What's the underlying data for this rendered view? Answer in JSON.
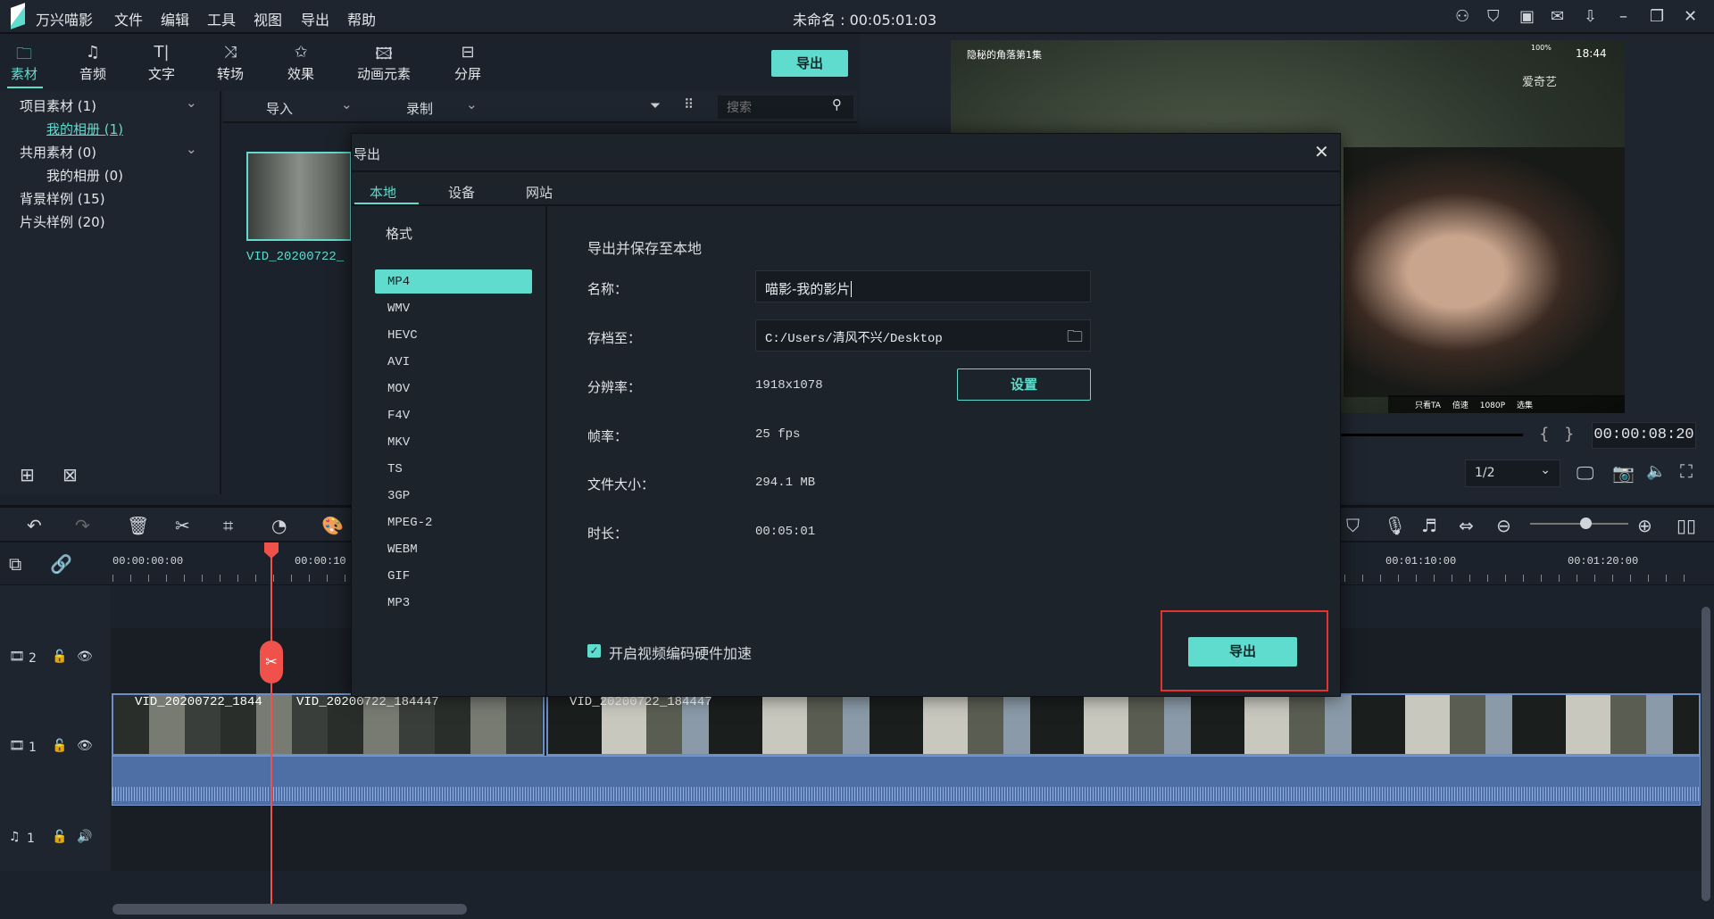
{
  "app": {
    "name": "万兴喵影",
    "title": "未命名 : 00:05:01:03",
    "menu": [
      "文件",
      "编辑",
      "工具",
      "视图",
      "导出",
      "帮助"
    ]
  },
  "window_icons": [
    "user-icon",
    "cart-icon",
    "save-icon",
    "mail-icon",
    "download-icon",
    "minimize-icon",
    "restore-icon",
    "close-icon"
  ],
  "tabs": [
    {
      "label": "素材",
      "icon": "folder-icon",
      "active": true
    },
    {
      "label": "音频",
      "icon": "music-icon"
    },
    {
      "label": "文字",
      "icon": "text-icon"
    },
    {
      "label": "转场",
      "icon": "transition-icon"
    },
    {
      "label": "效果",
      "icon": "effects-icon"
    },
    {
      "label": "动画元素",
      "icon": "image-icon"
    },
    {
      "label": "分屏",
      "icon": "split-screen-icon"
    }
  ],
  "export_top": "导出",
  "sidebar": {
    "items": [
      {
        "label": "项目素材 (1)"
      },
      {
        "label": "我的相册 (1)"
      },
      {
        "label": "共用素材 (0)"
      },
      {
        "label": "我的相册 (0)"
      },
      {
        "label": "背景样例 (15)"
      },
      {
        "label": "片头样例 (20)"
      }
    ]
  },
  "media": {
    "import": "导入",
    "record": "录制",
    "search_placeholder": "搜索",
    "clip_name": "VID_20200722_"
  },
  "preview": {
    "overlay_title": "隐秘的角落第1集",
    "clock": "18:44",
    "battery": "100%",
    "brand": "爱奇艺",
    "controls": [
      "只看TA",
      "倍速",
      "1080P",
      "选集"
    ],
    "timecode": "00:00:08:20",
    "quality": "1/2"
  },
  "timeline": {
    "ticks": [
      "00:00:00:00",
      "00:00:10",
      "00:01:10:00",
      "00:01:20:00"
    ],
    "tracks": [
      {
        "label": "2"
      },
      {
        "label": "1"
      },
      {
        "label": "1"
      }
    ],
    "clips": [
      "VID_20200722_1844",
      "VID_20200722_184447",
      "VID_20200722_184447"
    ]
  },
  "dialog": {
    "title": "导出",
    "tabs": [
      "本地",
      "设备",
      "网站"
    ],
    "format_heading": "格式",
    "formats": [
      "MP4",
      "WMV",
      "HEVC",
      "AVI",
      "MOV",
      "F4V",
      "MKV",
      "TS",
      "3GP",
      "MPEG-2",
      "WEBM",
      "GIF",
      "MP3"
    ],
    "selected_format": "MP4",
    "heading": "导出并保存至本地",
    "name_label": "名称：",
    "name_value": "喵影-我的影片",
    "path_label": "存档至：",
    "path_value": "C:/Users/清风不兴/Desktop",
    "res_label": "分辨率：",
    "res_value": "1918x1078",
    "settings": "设置",
    "fps_label": "帧率：",
    "fps_value": "25 fps",
    "size_label": "文件大小：",
    "size_value": "294.1 MB",
    "dur_label": "时长：",
    "dur_value": "00:05:01",
    "hw_label": "开启视频编码硬件加速",
    "hw_checked": true,
    "export": "导出"
  },
  "colors": {
    "accent": "#5fdccd",
    "playhead": "#f0524b",
    "highlight_box": "#e5322d"
  }
}
